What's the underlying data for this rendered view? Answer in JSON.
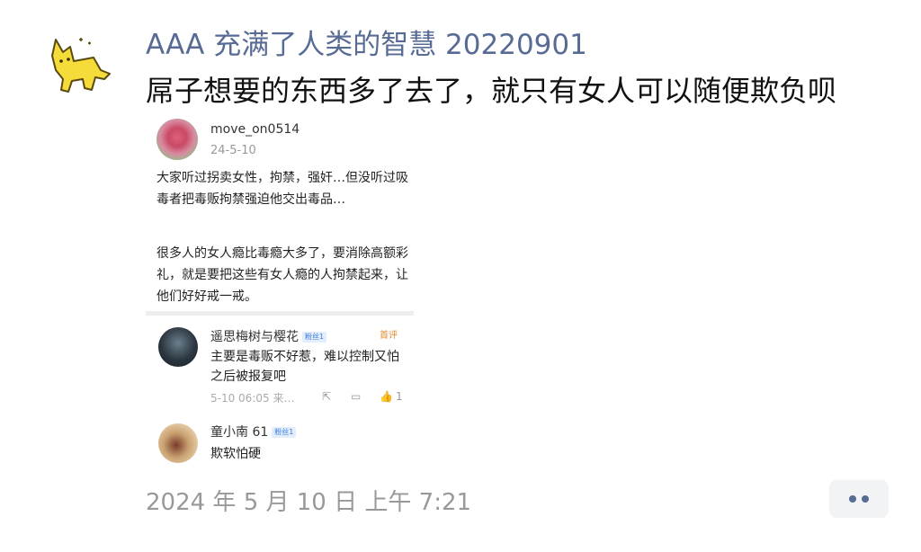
{
  "post": {
    "username": "AAA 充满了人类的智慧 20220901",
    "text": "屌子想要的东西多了去了，就只有女人可以随便欺负呗",
    "timestamp": "2024 年 5 月 10 日 上午 7:21"
  },
  "image": {
    "author": "move_on0514",
    "date": "24-5-10",
    "paragraph1": "大家听过拐卖女性，拘禁，强奸…但没听过吸毒者把毒贩拘禁强迫他交出毒品…",
    "paragraph2": "很多人的女人瘾比毒瘾大多了，要消除高额彩礼，就是要把这些有女人瘾的人拘禁起来，让他们好好戒一戒。",
    "comments": [
      {
        "name": "遥思梅树与樱花",
        "badge": "粉丝1",
        "first_label": "首评",
        "text": "主要是毒贩不好惹，难以控制又怕之后被报复吧",
        "time": "5-10 06:05 来…",
        "likes": "1"
      },
      {
        "name": "童小南 61",
        "badge": "粉丝1",
        "text": "欺软怕硬"
      }
    ]
  },
  "icons": {
    "avatar": "cat-icon",
    "more": "more-dots-icon",
    "share": "share-icon",
    "comment": "comment-icon",
    "like": "thumbs-up-icon"
  },
  "colors": {
    "username": "#576b95",
    "timestamp": "#999999"
  }
}
